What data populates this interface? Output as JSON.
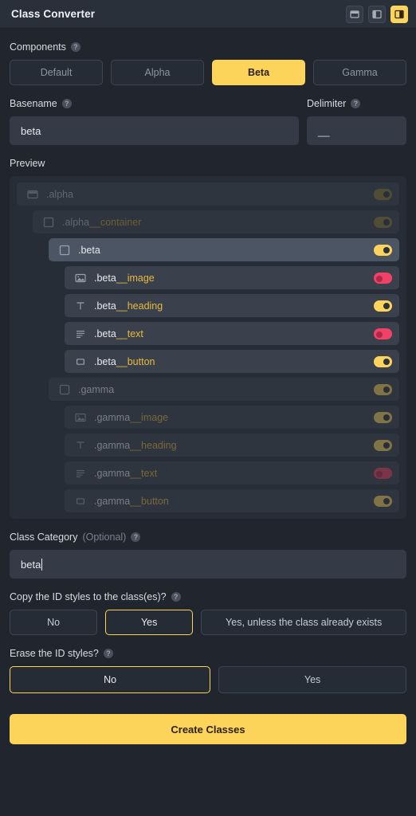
{
  "titlebar": {
    "title": "Class Converter",
    "view_buttons": [
      {
        "name": "panel-window-icon",
        "active": false
      },
      {
        "name": "panel-split-left-icon",
        "active": false
      },
      {
        "name": "panel-split-right-icon",
        "active": true
      }
    ]
  },
  "components": {
    "label": "Components",
    "help": "?",
    "options": [
      "Default",
      "Alpha",
      "Beta",
      "Gamma"
    ],
    "selected": "Beta"
  },
  "basename": {
    "label": "Basename",
    "help": "?",
    "value": "beta"
  },
  "delimiter": {
    "label": "Delimiter",
    "help": "?",
    "value": "__"
  },
  "preview": {
    "label": "Preview",
    "rows": [
      {
        "prefix": ".alpha",
        "suffix": "",
        "icon": "body-icon",
        "level": 0,
        "toggle": "on-dim",
        "state": "dim-parent"
      },
      {
        "prefix": ".alpha",
        "suffix": "__container",
        "icon": "div-icon",
        "level": 1,
        "toggle": "on-dim",
        "state": "dim-parent"
      },
      {
        "prefix": ".beta",
        "suffix": "",
        "icon": "div-icon",
        "level": 2,
        "toggle": "on",
        "state": "selected"
      },
      {
        "prefix": ".beta",
        "suffix": "__image",
        "icon": "image-icon",
        "level": 3,
        "toggle": "off",
        "state": "normal"
      },
      {
        "prefix": ".beta",
        "suffix": "__heading",
        "icon": "heading-icon",
        "level": 3,
        "toggle": "on",
        "state": "normal"
      },
      {
        "prefix": ".beta",
        "suffix": "__text",
        "icon": "text-icon",
        "level": 3,
        "toggle": "off",
        "state": "normal"
      },
      {
        "prefix": ".beta",
        "suffix": "__button",
        "icon": "button-icon",
        "level": 3,
        "toggle": "on",
        "state": "normal"
      },
      {
        "prefix": ".gamma",
        "suffix": "",
        "icon": "div-icon",
        "level": 2,
        "toggle": "on",
        "state": "dim"
      },
      {
        "prefix": ".gamma",
        "suffix": "__image",
        "icon": "image-icon",
        "level": 3,
        "toggle": "on",
        "state": "dim"
      },
      {
        "prefix": ".gamma",
        "suffix": "__heading",
        "icon": "heading-icon",
        "level": 3,
        "toggle": "on",
        "state": "dim"
      },
      {
        "prefix": ".gamma",
        "suffix": "__text",
        "icon": "text-icon",
        "level": 3,
        "toggle": "off",
        "state": "dim"
      },
      {
        "prefix": ".gamma",
        "suffix": "__button",
        "icon": "button-icon",
        "level": 3,
        "toggle": "on",
        "state": "dim"
      }
    ]
  },
  "class_category": {
    "label": "Class Category",
    "optional": "(Optional)",
    "help": "?",
    "value": "beta"
  },
  "copy_styles": {
    "label": "Copy the ID styles to the class(es)?",
    "help": "?",
    "options": [
      "No",
      "Yes",
      "Yes, unless the class already exists"
    ],
    "selected": "Yes"
  },
  "erase_styles": {
    "label": "Erase the ID styles?",
    "help": "?",
    "options": [
      "No",
      "Yes"
    ],
    "selected": "No"
  },
  "submit": {
    "label": "Create Classes"
  },
  "colors": {
    "accent": "#fcd45a",
    "danger": "#ef4266",
    "bg": "#21262e",
    "panel": "#272d36",
    "row": "#3a414c",
    "row_selected": "#4c5563",
    "suffix_text": "#e8b93e"
  }
}
